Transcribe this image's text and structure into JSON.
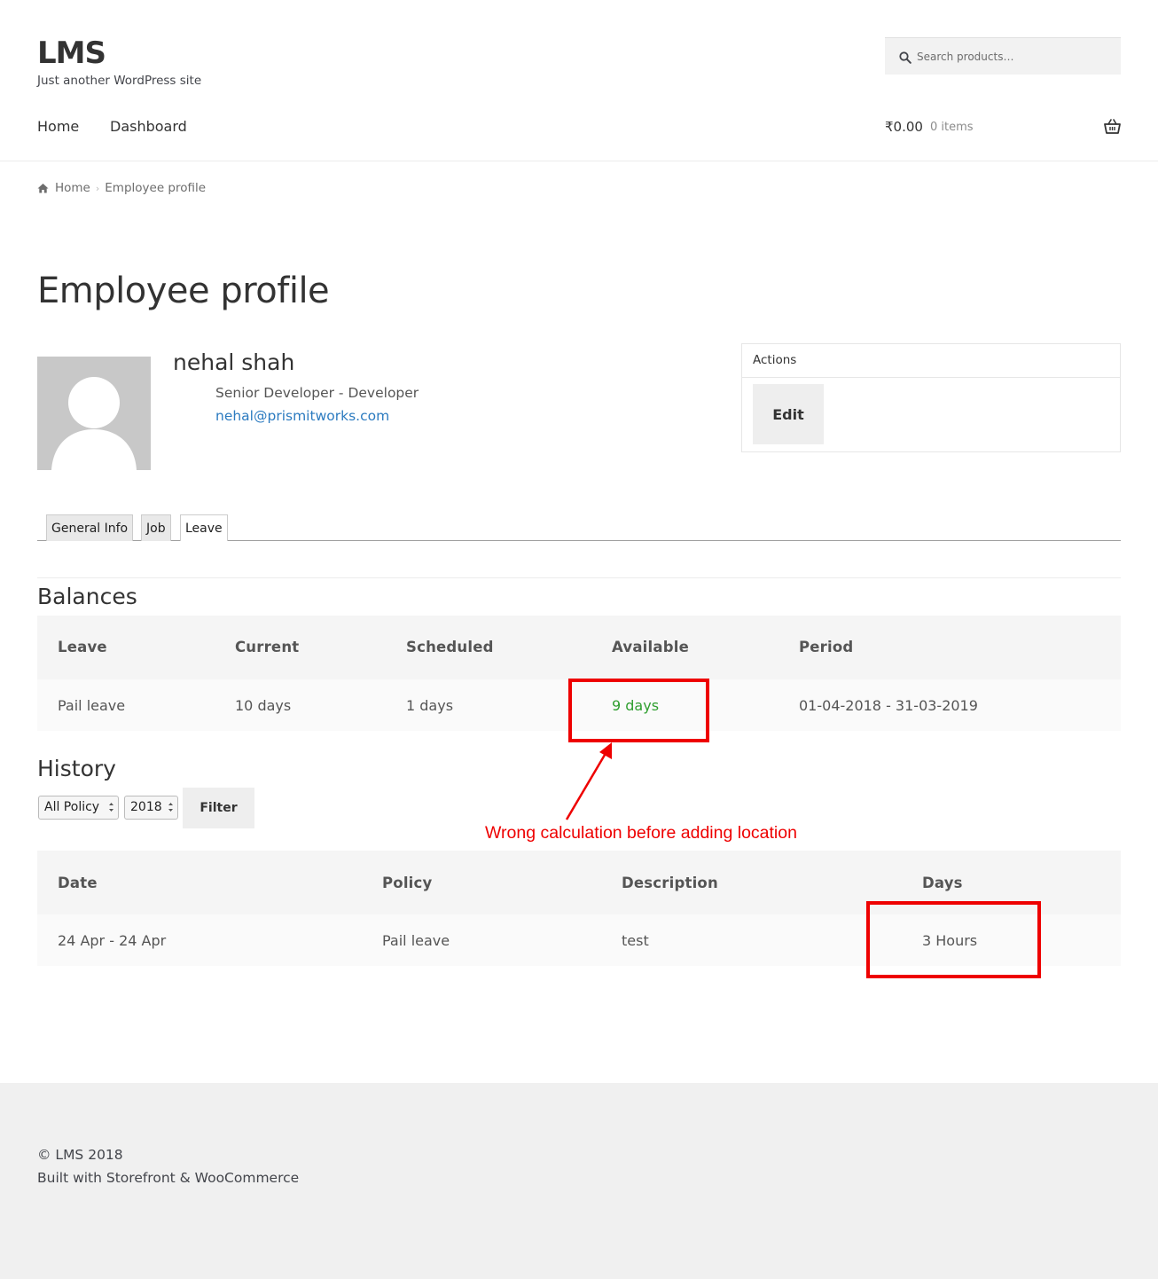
{
  "site": {
    "title": "LMS",
    "description": "Just another WordPress site"
  },
  "search": {
    "placeholder": "Search products…",
    "icon": "search-icon"
  },
  "nav": {
    "items": [
      {
        "label": "Home"
      },
      {
        "label": "Dashboard"
      }
    ]
  },
  "cart": {
    "amount": "₹0.00",
    "count": "0 items",
    "icon": "basket-icon"
  },
  "breadcrumb": {
    "home": "Home",
    "current": "Employee profile"
  },
  "page": {
    "title": "Employee profile"
  },
  "profile": {
    "name": "nehal shah",
    "role": "Senior Developer - Developer",
    "email": "nehal@prismitworks.com"
  },
  "actions": {
    "title": "Actions",
    "edit_label": "Edit"
  },
  "tabs": [
    {
      "label": "General Info",
      "active": false
    },
    {
      "label": "Job",
      "active": false
    },
    {
      "label": "Leave",
      "active": true
    }
  ],
  "balances": {
    "title": "Balances",
    "headers": [
      "Leave",
      "Current",
      "Scheduled",
      "Available",
      "Period"
    ],
    "rows": [
      {
        "leave": "Pail leave",
        "current": "10 days",
        "scheduled": "1 days",
        "available": "9 days",
        "period": "01-04-2018 - 31-03-2019"
      }
    ]
  },
  "history": {
    "title": "History",
    "policy_select": "All Policy",
    "year_select": "2018",
    "filter_label": "Filter",
    "headers": [
      "Date",
      "Policy",
      "Description",
      "Days"
    ],
    "rows": [
      {
        "date": "24 Apr - 24 Apr",
        "policy": "Pail leave",
        "description": "test",
        "days": "3 Hours"
      }
    ]
  },
  "annotation": {
    "text": "Wrong calculation before adding location",
    "color": "#ee0000"
  },
  "footer": {
    "copyright": "© LMS 2018",
    "built_with": "Built with Storefront & WooCommerce"
  },
  "colors": {
    "link": "#2c7bc0",
    "available": "#2e9e2e"
  }
}
